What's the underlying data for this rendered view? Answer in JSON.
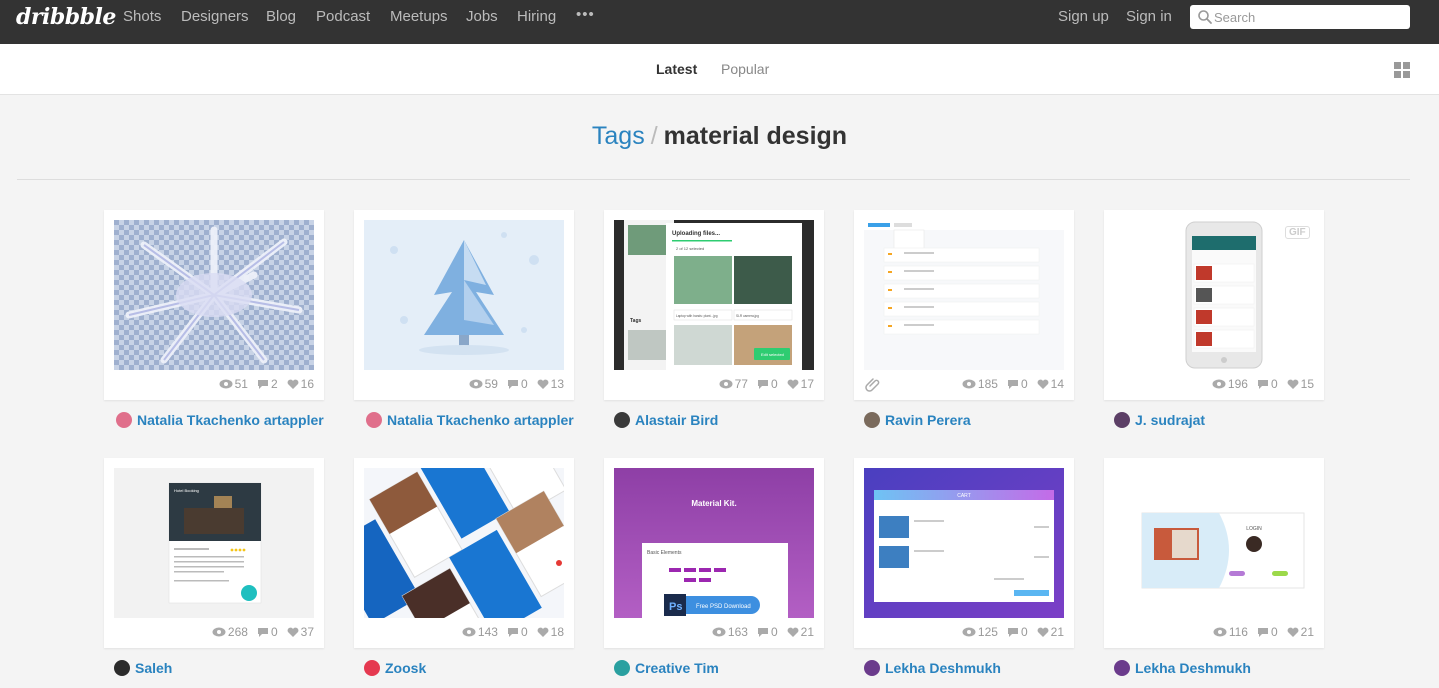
{
  "app": {
    "logo": "dribbble",
    "nav": [
      "Shots",
      "Designers",
      "Blog",
      "Podcast",
      "Meetups",
      "Jobs",
      "Hiring"
    ],
    "more": "•••",
    "sign_up": "Sign up",
    "sign_in": "Sign in",
    "search_placeholder": "Search"
  },
  "tabs": {
    "latest": "Latest",
    "popular": "Popular"
  },
  "title": {
    "crumb": "Tags",
    "sep": "/",
    "tag": "material design"
  },
  "colors": {
    "accent": "#2a83bf",
    "topbar": "#333333",
    "background": "#f4f4f4"
  },
  "shots": [
    {
      "views": "51",
      "comments": "2",
      "likes": "16",
      "author": "Natalia Tkachenko artappler",
      "attachment": false,
      "gif": false
    },
    {
      "views": "59",
      "comments": "0",
      "likes": "13",
      "author": "Natalia Tkachenko artappler",
      "attachment": false,
      "gif": false
    },
    {
      "views": "77",
      "comments": "0",
      "likes": "17",
      "author": "Alastair Bird",
      "attachment": false,
      "gif": false
    },
    {
      "views": "185",
      "comments": "0",
      "likes": "14",
      "author": "Ravin Perera",
      "attachment": true,
      "gif": false
    },
    {
      "views": "196",
      "comments": "0",
      "likes": "15",
      "author": "J. sudrajat",
      "attachment": false,
      "gif": true,
      "gif_label": "GIF"
    },
    {
      "views": "268",
      "comments": "0",
      "likes": "37",
      "author": "Saleh",
      "attachment": false,
      "gif": false
    },
    {
      "views": "143",
      "comments": "0",
      "likes": "18",
      "author": "Zoosk",
      "attachment": false,
      "gif": false
    },
    {
      "views": "163",
      "comments": "0",
      "likes": "21",
      "author": "Creative Tim",
      "attachment": false,
      "gif": false
    },
    {
      "views": "125",
      "comments": "0",
      "likes": "21",
      "author": "Lekha Deshmukh",
      "attachment": false,
      "gif": false
    },
    {
      "views": "116",
      "comments": "0",
      "likes": "21",
      "author": "Lekha Deshmukh",
      "attachment": false,
      "gif": false
    }
  ],
  "thumb_text": {
    "s3_title": "Uploading files...",
    "s3_sub": "2 of 12 selected",
    "s3_btn": "Edit selected",
    "s3_tags": "Tags",
    "s3_cap1": "Laptop with hands: plant...jpg",
    "s3_cap2": "SLR camera.jpg",
    "s6_title": "Hotel Booking",
    "s8_title": "Material Kit.",
    "s8_section": "Basic Elements",
    "s8_btn": "Free PSD Download",
    "s9_header": "CART",
    "s10_login": "LOGIN"
  }
}
